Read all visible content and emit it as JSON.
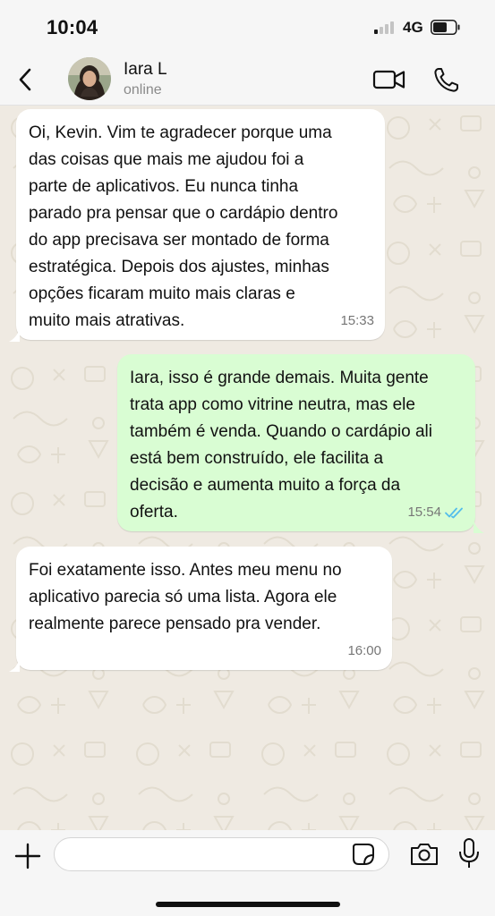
{
  "status_bar": {
    "time": "10:04",
    "network": "4G",
    "signal_bars_active": 1,
    "signal_bars_total": 4
  },
  "header": {
    "contact_name": "Iara L",
    "contact_status": "online",
    "icons": [
      "back-chevron-icon",
      "video-camera-icon",
      "phone-icon"
    ]
  },
  "messages": [
    {
      "direction": "incoming",
      "text": "Oi, Kevin. Vim te agradecer porque uma\ndas coisas que mais me ajudou foi a\nparte de aplicativos. Eu nunca tinha\nparado pra pensar que o cardápio dentro\ndo app precisava ser montado de forma\nestratégica. Depois dos ajustes, minhas\nopções ficaram muito mais claras e\nmuito mais atrativas.",
      "time": "15:33"
    },
    {
      "direction": "outgoing",
      "text": "Iara, isso é grande demais. Muita gente\ntrata app como vitrine neutra, mas ele\ntambém é venda. Quando o cardápio ali\nestá bem construído, ele facilita a\ndecisão e aumenta muito a força da\noferta.",
      "time": "15:54",
      "read": true
    },
    {
      "direction": "incoming",
      "text": "Foi exatamente isso. Antes meu menu no\naplicativo parecia só uma lista. Agora ele\nrealmente parece pensado pra vender.",
      "time": "16:00"
    }
  ],
  "composer": {
    "input_value": "",
    "input_placeholder": "",
    "icons": [
      "plus-icon",
      "sticker-icon",
      "camera-icon",
      "microphone-icon"
    ]
  },
  "colors": {
    "chat_background": "#efeae2",
    "incoming_bubble": "#ffffff",
    "outgoing_bubble": "#d9fdd3",
    "read_ticks": "#53bdeb",
    "bar_background": "#f6f6f6"
  }
}
